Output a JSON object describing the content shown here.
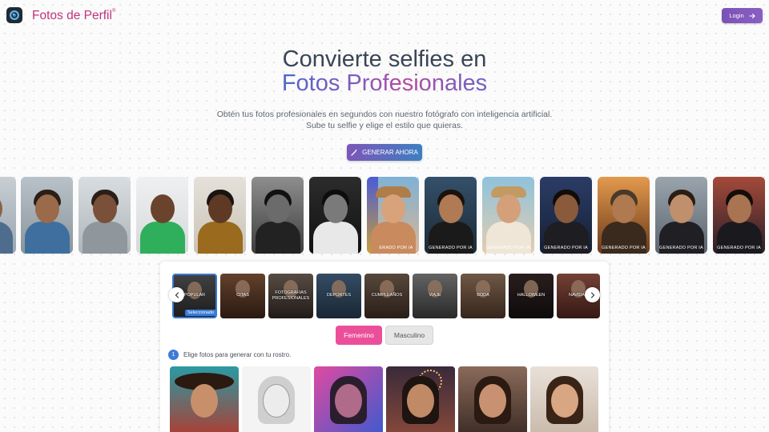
{
  "header": {
    "brand": "Fotos de Perfil",
    "brand_mark": "®",
    "logo_icon": "camera-lens-icon",
    "login_label": "Login",
    "login_icon": "arrow-right-icon"
  },
  "hero": {
    "title_line1": "Convierte selfies en",
    "title_line2": "Fotos Profesionales",
    "subtitle_line1": "Obtén tus fotos profesionales en segundos con nuestro fotógrafo con inteligencia artificial.",
    "subtitle_line2": "Sube tu selfie y elige el estilo que quieras.",
    "cta_label": "GENERAR AHORA",
    "cta_icon": "magic-wand-icon"
  },
  "carousel": {
    "ai_tag_partial": "ERADO POR IA",
    "ai_tag": "GENERADO POR IA"
  },
  "styles": {
    "categories": [
      "POPULAR",
      "CITAS",
      "FOTOGRAFIAS PROFESIONALES",
      "DEPORTES",
      "CUMPLEAÑOS",
      "VIAJE",
      "BODA",
      "HALLOWEEN",
      "NAVIDAD"
    ],
    "selected_badge": "Seleccionado",
    "prev_icon": "chevron-left-icon",
    "next_icon": "chevron-right-icon"
  },
  "gender": {
    "female": "Femenino",
    "male": "Masculino"
  },
  "step": {
    "number": "1",
    "text": "Elige fotos para generar con tu rostro."
  },
  "colors": {
    "brand": "#c0347a",
    "accent_blue": "#3e7ad8",
    "pink": "#ec4f9a",
    "purple": "#7a52b5"
  }
}
